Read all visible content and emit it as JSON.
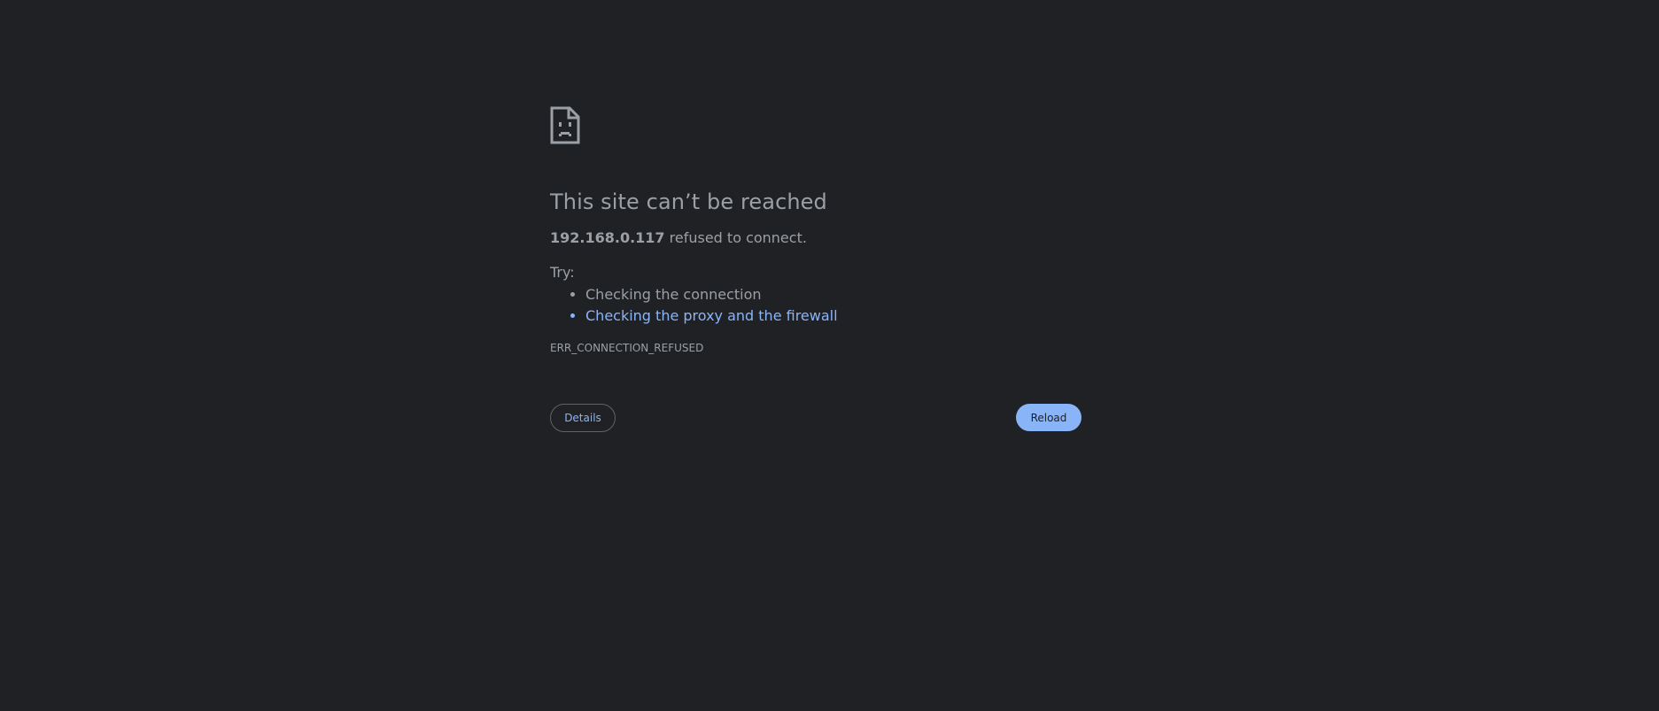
{
  "page": {
    "background": "#202124",
    "text_color": "#9aa0a6",
    "link_color": "#8ab4f8"
  },
  "error_page": {
    "icon": "sad-document-icon",
    "title": "This site can’t be reached",
    "host": "192.168.0.117",
    "summary_suffix": " refused to connect.",
    "try_label": "Try:",
    "suggestions": [
      {
        "label": "Checking the connection",
        "is_link": false
      },
      {
        "label": "Checking the proxy and the firewall",
        "is_link": true
      }
    ],
    "error_code": "ERR_CONNECTION_REFUSED"
  },
  "buttons": {
    "details_label": "Details",
    "reload_label": "Reload"
  }
}
